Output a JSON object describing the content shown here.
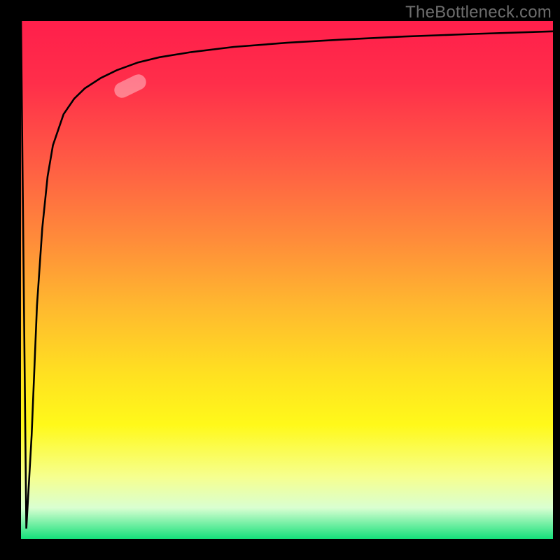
{
  "watermark": "TheBottleneck.com",
  "gradient_stops": [
    {
      "pct": 0,
      "color": "#ff1f4b"
    },
    {
      "pct": 12,
      "color": "#ff2e4a"
    },
    {
      "pct": 28,
      "color": "#ff5e44"
    },
    {
      "pct": 42,
      "color": "#ff8b3a"
    },
    {
      "pct": 55,
      "color": "#ffb82f"
    },
    {
      "pct": 68,
      "color": "#ffe021"
    },
    {
      "pct": 78,
      "color": "#fff91a"
    },
    {
      "pct": 88,
      "color": "#f6ff8f"
    },
    {
      "pct": 94,
      "color": "#d9ffd1"
    },
    {
      "pct": 100,
      "color": "#14e07a"
    }
  ],
  "marker": {
    "x_frac": 0.205,
    "y_frac": 0.125
  },
  "chart_data": {
    "type": "line",
    "title": "",
    "xlabel": "",
    "ylabel": "",
    "xlim": [
      0,
      100
    ],
    "ylim": [
      0,
      100
    ],
    "series": [
      {
        "name": "curve",
        "x": [
          0,
          1,
          2,
          3,
          4,
          5,
          6,
          8,
          10,
          12,
          15,
          18,
          22,
          26,
          32,
          40,
          50,
          60,
          72,
          85,
          100
        ],
        "y": [
          100,
          2,
          20,
          45,
          60,
          70,
          76,
          82,
          85,
          87,
          89,
          90.5,
          92,
          93,
          94,
          95,
          95.8,
          96.4,
          97,
          97.5,
          98
        ]
      }
    ],
    "annotations": [
      {
        "type": "marker",
        "x": 20.5,
        "y": 91,
        "label": ""
      }
    ]
  }
}
